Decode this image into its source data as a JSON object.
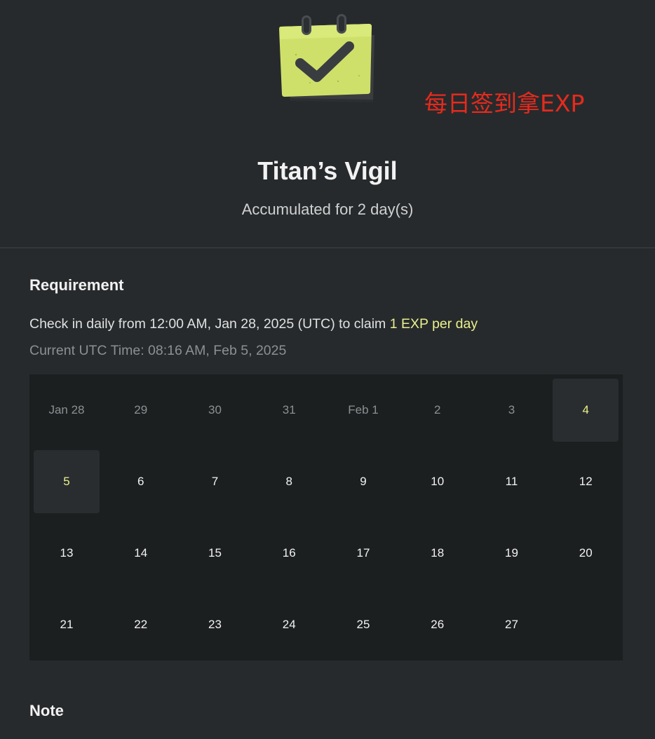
{
  "promo_text": "每日签到拿EXP",
  "title": "Titan’s Vigil",
  "subtitle": "Accumulated for 2 day(s)",
  "requirement": {
    "heading": "Requirement",
    "text_prefix": "Check in daily from 12:00 AM, Jan 28, 2025 (UTC) to claim ",
    "text_highlight": "1 EXP per day",
    "current_time": "Current UTC Time: 08:16 AM, Feb 5, 2025"
  },
  "note": {
    "heading": "Note"
  },
  "calendar": {
    "days": [
      {
        "label": "Jan 28",
        "state": "past"
      },
      {
        "label": "29",
        "state": "past"
      },
      {
        "label": "30",
        "state": "past"
      },
      {
        "label": "31",
        "state": "past"
      },
      {
        "label": "Feb 1",
        "state": "past"
      },
      {
        "label": "2",
        "state": "past"
      },
      {
        "label": "3",
        "state": "past"
      },
      {
        "label": "4",
        "state": "checked"
      },
      {
        "label": "5",
        "state": "checked"
      },
      {
        "label": "6",
        "state": "future"
      },
      {
        "label": "7",
        "state": "future"
      },
      {
        "label": "8",
        "state": "future"
      },
      {
        "label": "9",
        "state": "future"
      },
      {
        "label": "10",
        "state": "future"
      },
      {
        "label": "11",
        "state": "future"
      },
      {
        "label": "12",
        "state": "future"
      },
      {
        "label": "13",
        "state": "future"
      },
      {
        "label": "14",
        "state": "future"
      },
      {
        "label": "15",
        "state": "future"
      },
      {
        "label": "16",
        "state": "future"
      },
      {
        "label": "17",
        "state": "future"
      },
      {
        "label": "18",
        "state": "future"
      },
      {
        "label": "19",
        "state": "future"
      },
      {
        "label": "20",
        "state": "future"
      },
      {
        "label": "21",
        "state": "future"
      },
      {
        "label": "22",
        "state": "future"
      },
      {
        "label": "23",
        "state": "future"
      },
      {
        "label": "24",
        "state": "future"
      },
      {
        "label": "25",
        "state": "future"
      },
      {
        "label": "26",
        "state": "future"
      },
      {
        "label": "27",
        "state": "future"
      }
    ]
  },
  "colors": {
    "background": "#272a2c",
    "calendar_background": "#1c1f20",
    "accent": "#e9f08d",
    "promo": "#e62a1e"
  },
  "icons": {
    "hero": "calendar-check-icon"
  }
}
